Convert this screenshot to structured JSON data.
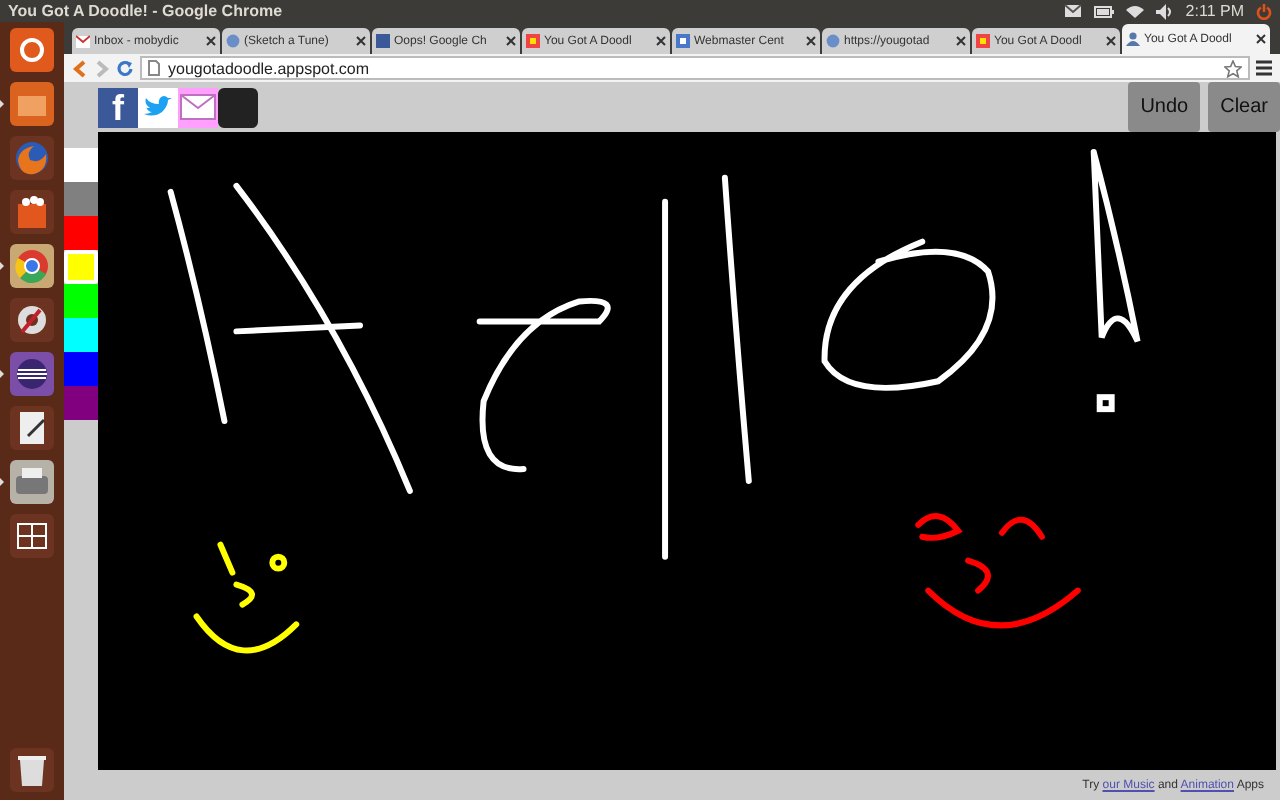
{
  "window": {
    "title": "You Got A Doodle! - Google Chrome"
  },
  "panel": {
    "time": "2:11 PM"
  },
  "launcher": [
    {
      "kind": "ubuntu",
      "running": false
    },
    {
      "kind": "files",
      "running": true
    },
    {
      "kind": "firefox",
      "running": false
    },
    {
      "kind": "media",
      "running": false
    },
    {
      "kind": "chrome",
      "running": true
    },
    {
      "kind": "settings",
      "running": false
    },
    {
      "kind": "eclipse",
      "running": true
    },
    {
      "kind": "editor",
      "running": false
    },
    {
      "kind": "scanner",
      "running": true
    },
    {
      "kind": "workspaces",
      "running": false
    },
    {
      "kind": "trash",
      "running": false
    }
  ],
  "tabs": [
    {
      "label": "Inbox - mobydic",
      "kind": "mail",
      "selected": false
    },
    {
      "label": "(Sketch a Tune)",
      "kind": "globe",
      "selected": false
    },
    {
      "label": "Oops! Google Ch",
      "kind": "facebook",
      "selected": false
    },
    {
      "label": "You Got A Doodl",
      "kind": "doodle",
      "selected": false
    },
    {
      "label": "Webmaster Cent",
      "kind": "shield",
      "selected": false
    },
    {
      "label": "https://yougotad",
      "kind": "globe",
      "selected": false
    },
    {
      "label": "You Got A Doodl",
      "kind": "doodle",
      "selected": false
    },
    {
      "label": "You Got A Doodl",
      "kind": "person",
      "selected": true
    }
  ],
  "address": {
    "url": "yougotadoodle.appspot.com"
  },
  "share": [
    {
      "kind": "facebook",
      "glyph": "f"
    },
    {
      "kind": "twitter"
    },
    {
      "kind": "email"
    },
    {
      "kind": "dark"
    }
  ],
  "buttons": [
    "Undo",
    "Clear"
  ],
  "palette": [
    {
      "color": "#ffffff",
      "selected": false
    },
    {
      "color": "#808080",
      "selected": false
    },
    {
      "color": "#ff0000",
      "selected": false
    },
    {
      "color": "#ffff00",
      "selected": true
    },
    {
      "color": "#00ff00",
      "selected": false
    },
    {
      "color": "#00ffff",
      "selected": false
    },
    {
      "color": "#0000ff",
      "selected": false
    },
    {
      "color": "#800080",
      "selected": false
    }
  ],
  "footer": {
    "prefix": "Try",
    "link_1": "our Music",
    "middle": "and",
    "link_2": "Animation",
    "suffix": "Apps"
  }
}
